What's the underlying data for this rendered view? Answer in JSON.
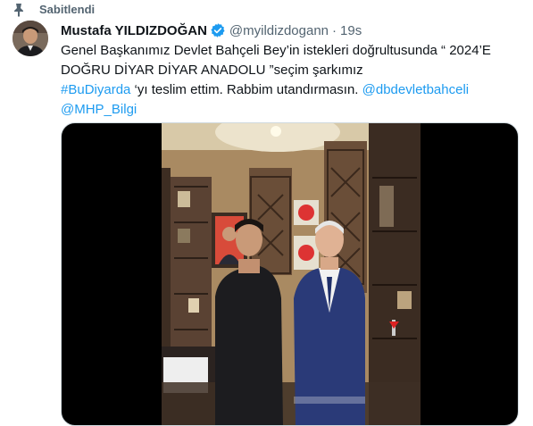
{
  "pinned": {
    "label": "Sabitlendi",
    "icon": "pin-icon"
  },
  "author": {
    "name": "Mustafa YILDIZDOĞAN",
    "handle": "@myildizdogann",
    "separator": "·",
    "time": "19s",
    "verified_icon": "verified-badge-icon",
    "avatar_icon": "avatar"
  },
  "tweet": {
    "line1": "Genel Başkanımız Devlet Bahçeli Bey’in istekleri doğrultusunda “ 2024’E",
    "line2": "DOĞRU DİYAR DİYAR ANADOLU ”seçim şarkımız",
    "hashtag": "#BuDiyarda",
    "line3_rest": " ‘yı teslim ettim. Rabbim utandırmasın. ",
    "mention1": "@dbdevletbahceli",
    "mention2": "@MHP_Bilgi"
  },
  "media": {
    "icon": "photo-two-men-in-office"
  },
  "colors": {
    "link": "#1d9bf0",
    "secondary_text": "#536471",
    "verified": "#1d9bf0",
    "media_background": "#000000"
  }
}
